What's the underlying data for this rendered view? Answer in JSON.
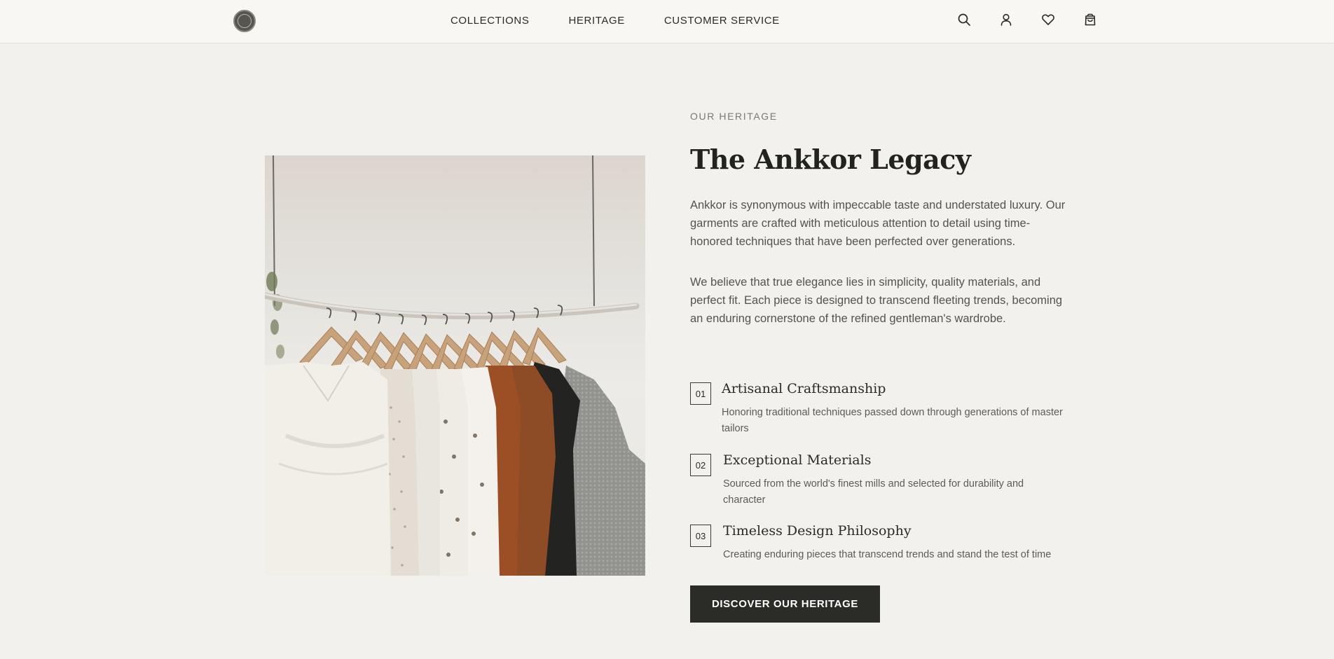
{
  "header": {
    "nav": [
      {
        "label": "COLLECTIONS"
      },
      {
        "label": "HERITAGE"
      },
      {
        "label": "CUSTOMER SERVICE"
      }
    ],
    "icons": [
      "search-icon",
      "user-icon",
      "heart-icon",
      "shopping-bag-icon"
    ]
  },
  "heritage": {
    "eyebrow": "OUR HERITAGE",
    "title": "The Ankkor Legacy",
    "paragraph_1": "Ankkor is synonymous with impeccable taste and understated luxury. Our garments are crafted with meticulous attention to detail using time-honored techniques that have been perfected over generations.",
    "paragraph_2": "We believe that true elegance lies in simplicity, quality materials, and perfect fit. Each piece is designed to transcend fleeting trends, becoming an enduring cornerstone of the refined gentleman's wardrobe.",
    "features": [
      {
        "number": "01",
        "title": "Artisanal Craftsmanship",
        "description": "Honoring traditional techniques passed down through generations of master tailors"
      },
      {
        "number": "02",
        "title": "Exceptional Materials",
        "description": "Sourced from the world's finest mills and selected for durability and character"
      },
      {
        "number": "03",
        "title": "Timeless Design Philosophy",
        "description": "Creating enduring pieces that transcend trends and stand the test of time"
      }
    ],
    "cta_label": "DISCOVER OUR HERITAGE"
  },
  "colors": {
    "background": "#f3f1ed",
    "header_bg": "#f8f7f3",
    "text_dark": "#2a2a26",
    "button_bg": "#2b2b27",
    "button_text": "#ffffff"
  }
}
